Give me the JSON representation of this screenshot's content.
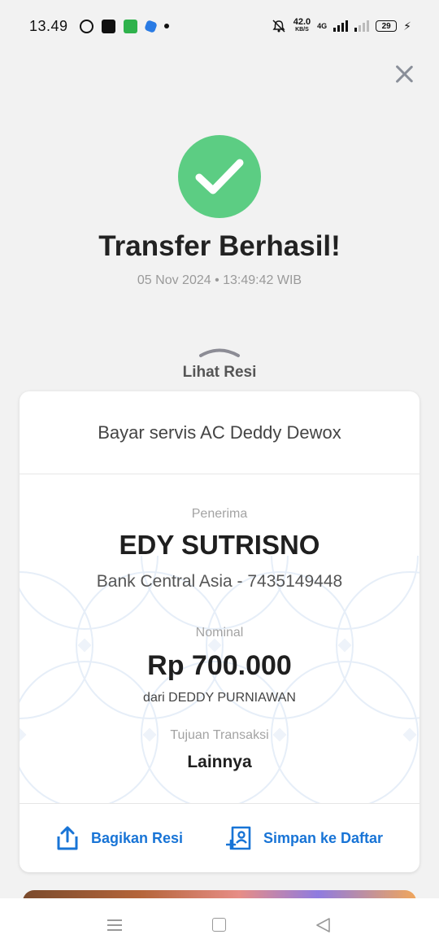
{
  "status_bar": {
    "time": "13.49",
    "icons": [
      "whatsapp-icon",
      "shopee-icon",
      "app-green-icon",
      "app-blue-icon",
      "dot-icon"
    ],
    "net_speed_value": "42.0",
    "net_speed_unit": "KB/S",
    "network": "4G",
    "battery": "29"
  },
  "header": {
    "close_icon": "close-icon"
  },
  "success": {
    "icon": "check-icon",
    "title": "Transfer Berhasil!",
    "datetime": "05 Nov 2024 • 13:49:42 WIB",
    "accent_color": "#5ccd83"
  },
  "receipt_toggle": {
    "label": "Lihat Resi",
    "icon": "chevron-up-icon"
  },
  "card": {
    "note": "Bayar servis AC Deddy Dewox",
    "recipient_label": "Penerima",
    "recipient_name": "EDY SUTRISNO",
    "recipient_bank": "Bank Central Asia - 7435149448",
    "amount_label": "Nominal",
    "amount": "Rp 700.000",
    "sender": "dari DEDDY PURNIAWAN",
    "purpose_label": "Tujuan Transaksi",
    "purpose": "Lainnya"
  },
  "actions": {
    "share_label": "Bagikan Resi",
    "save_label": "Simpan ke Daftar",
    "link_color": "#1874d6"
  },
  "nav_bar": {
    "items": [
      "menu-icon",
      "home-icon",
      "back-icon"
    ]
  }
}
